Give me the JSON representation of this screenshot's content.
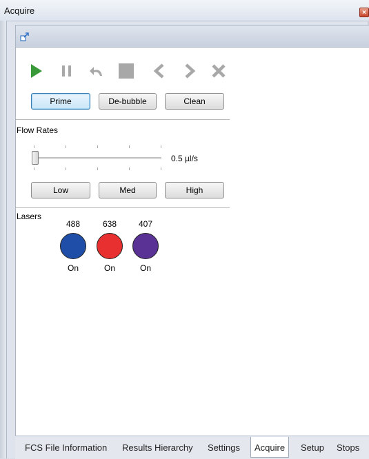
{
  "window": {
    "title": "Acquire",
    "close_glyph": "×"
  },
  "toolbar": {
    "dock_icon": "undock-icon"
  },
  "controls": {
    "icons": [
      "play-icon",
      "pause-icon",
      "undo-icon",
      "stop-icon",
      "previous-icon",
      "next-icon",
      "cancel-icon"
    ],
    "colors": {
      "play": "#3a9a3a",
      "disabled": "#a8a8a8"
    }
  },
  "fluidics": {
    "prime_label": "Prime",
    "debubble_label": "De-bubble",
    "clean_label": "Clean"
  },
  "flow_rates": {
    "heading": "Flow Rates",
    "value_text": "0.5 µl/s",
    "slider_level": 0,
    "low_label": "Low",
    "med_label": "Med",
    "high_label": "High"
  },
  "lasers": {
    "heading": "Lasers",
    "items": [
      {
        "wavelength": "488",
        "state": "On",
        "color": "#1f4ea8"
      },
      {
        "wavelength": "638",
        "state": "On",
        "color": "#e83030"
      },
      {
        "wavelength": "407",
        "state": "On",
        "color": "#5a3296"
      }
    ]
  },
  "tabs": {
    "items": [
      {
        "label": "FCS File Information"
      },
      {
        "label": "Results Hierarchy"
      },
      {
        "label": "Settings"
      },
      {
        "label": "Acquire",
        "active": true
      },
      {
        "label": "Setup"
      },
      {
        "label": "Stops"
      }
    ]
  }
}
